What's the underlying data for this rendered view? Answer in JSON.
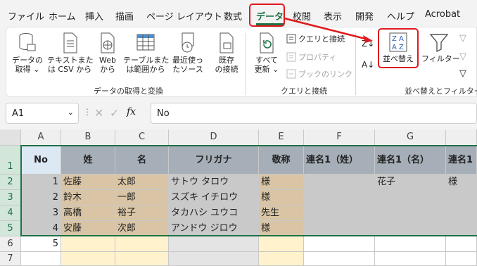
{
  "ribbon_tabs": [
    "ファイル",
    "ホーム",
    "挿入",
    "描画",
    "ページ レイアウト",
    "数式",
    "データ",
    "校閲",
    "表示",
    "開発",
    "ヘルプ",
    "Acrobat"
  ],
  "active_tab": "データ",
  "groups": {
    "get": "データの取得と変換",
    "query": "クエリと接続",
    "sort": "並べ替えとフィルター"
  },
  "buttons": {
    "get_data": [
      "データの",
      "取得 ⌄"
    ],
    "text_csv": [
      "テキストまた",
      "は CSV から"
    ],
    "web": [
      "Web",
      "から"
    ],
    "table_range": [
      "テーブルまた",
      "は範囲から"
    ],
    "recent": [
      "最近使っ",
      "たソース"
    ],
    "existing": [
      "既存",
      "の接続"
    ],
    "refresh_all": [
      "すべて",
      "更新 ⌄"
    ],
    "queries": "クエリと接続",
    "properties": "プロパティ",
    "links": "ブックのリンク",
    "sort": "並べ替え",
    "filter": "フィルター"
  },
  "formula_bar": {
    "name_box": "A1",
    "fx": "fx",
    "value": "No"
  },
  "columns": [
    "A",
    "B",
    "C",
    "D",
    "E",
    "F",
    "G",
    ""
  ],
  "rows": [
    "1",
    "2",
    "3",
    "4",
    "5",
    "6",
    "7"
  ],
  "table": {
    "header": [
      "No",
      "姓",
      "名",
      "フリガナ",
      "敬称",
      "連名1（姓）",
      "連名1（名）",
      "連名1"
    ],
    "data": [
      [
        "1",
        "佐藤",
        "太郎",
        "サトウ タロウ",
        "様",
        "",
        "花子",
        "様"
      ],
      [
        "2",
        "鈴木",
        "一郎",
        "スズキ イチロウ",
        "様",
        "",
        "",
        ""
      ],
      [
        "3",
        "高橋",
        "裕子",
        "タカハシ ユウコ",
        "先生",
        "",
        "",
        ""
      ],
      [
        "4",
        "安藤",
        "次郎",
        "アンドウ ジロウ",
        "様",
        "",
        "",
        ""
      ],
      [
        "5",
        "",
        "",
        "",
        "",
        "",
        "",
        ""
      ],
      [
        "",
        "",
        "",
        "",
        "",
        "",
        "",
        ""
      ]
    ]
  },
  "colors": {
    "accent": "#1e7145",
    "highlight": "#e0191c",
    "header_fill": "#a6aeb7",
    "beige": "#d9c5a5",
    "gray": "#c9c9c9",
    "cream": "#fff2cc"
  }
}
